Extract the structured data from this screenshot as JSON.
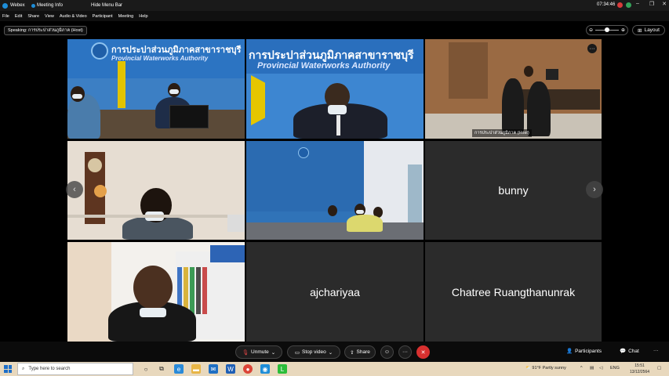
{
  "titlebar": {
    "app_name": "Webex",
    "meeting_info": "Meeting Info",
    "hide_menu": "Hide Menu Bar",
    "clock": "07:34:46",
    "minimize": "–",
    "maximize": "❐",
    "close": "✕"
  },
  "menu": [
    "File",
    "Edit",
    "Share",
    "View",
    "Audio & Video",
    "Participant",
    "Meeting",
    "Help"
  ],
  "speaking": "Speaking: การประปาส่วนภูมิภาค (Host)",
  "layout_label": "Layout",
  "tiles": {
    "t1": {
      "thai_title": "การประปาส่วนภูมิภาคสาขาราชบุรี",
      "eng_title": "Provincial Waterworks Authority"
    },
    "t2": {
      "thai_title": "การประปาส่วนภูมิภาคสาขาราชบุรี",
      "eng_title": "Provincial Waterworks Authority"
    },
    "t3": {
      "label": "การประปาส่วนภูมิภาค (Host)",
      "more": "···"
    },
    "t6": {
      "name": "bunny"
    },
    "t8": {
      "name": "ajchariyaa"
    },
    "t9": {
      "name": "Chatree Ruangthanunrak"
    }
  },
  "nav": {
    "prev": "‹",
    "next": "›"
  },
  "controls": {
    "unmute": "Unmute",
    "stop_video": "Stop video",
    "share": "Share",
    "reactions": "☺",
    "more": "···",
    "leave": "✕",
    "participants": "Participants",
    "chat": "Chat",
    "overflow": "···"
  },
  "taskbar": {
    "search_placeholder": "Type here to search",
    "weather": "91°F  Partly sunny",
    "time": "15:51",
    "date": "13/12/2564",
    "lang": "ENG"
  },
  "colors": {
    "accent": "#45b1e8",
    "leave": "#d8302f",
    "banner": "#2c77c7",
    "taskbar": "#e8d8bd"
  }
}
